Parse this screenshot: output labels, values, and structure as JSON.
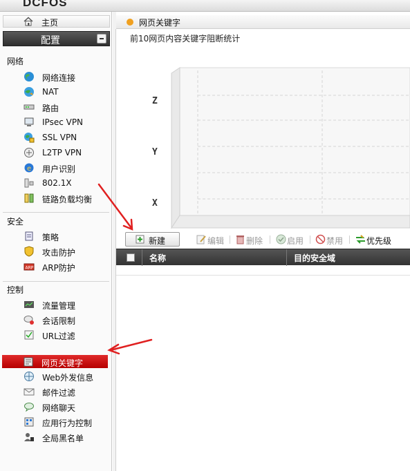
{
  "brand": {
    "name": "DCFOS"
  },
  "sidebar": {
    "home_label": "主页",
    "config_label": "配置",
    "groups": [
      {
        "title": "网络",
        "items": [
          {
            "label": "网络连接",
            "icon": "globe-icon"
          },
          {
            "label": "NAT",
            "icon": "nat-globe-icon"
          },
          {
            "label": "路由",
            "icon": "router-icon"
          },
          {
            "label": "IPsec VPN",
            "icon": "vpn-monitor-icon"
          },
          {
            "label": "SSL VPN",
            "icon": "ssl-vpn-icon"
          },
          {
            "label": "L2TP VPN",
            "icon": "l2tp-vpn-icon"
          },
          {
            "label": "用户识别",
            "icon": "ie-globe-icon"
          },
          {
            "label": "802.1X",
            "icon": "switch-icon"
          },
          {
            "label": "链路负载均衡",
            "icon": "load-balance-icon"
          }
        ]
      },
      {
        "title": "安全",
        "items": [
          {
            "label": "策略",
            "icon": "policy-icon"
          },
          {
            "label": "攻击防护",
            "icon": "shield-icon"
          },
          {
            "label": "ARP防护",
            "icon": "arp-icon"
          }
        ]
      },
      {
        "title": "控制",
        "items": [
          {
            "label": "流量管理",
            "icon": "traffic-icon"
          },
          {
            "label": "会话限制",
            "icon": "session-icon"
          },
          {
            "label": "URL过滤",
            "icon": "url-filter-icon"
          },
          {
            "label": "网页关键字",
            "icon": "keyword-icon",
            "active": true
          },
          {
            "label": "Web外发信息",
            "icon": "web-post-icon"
          },
          {
            "label": "邮件过滤",
            "icon": "mail-filter-icon"
          },
          {
            "label": "网络聊天",
            "icon": "chat-icon"
          },
          {
            "label": "应用行为控制",
            "icon": "app-control-icon"
          },
          {
            "label": "全局黑名单",
            "icon": "blacklist-icon"
          }
        ]
      }
    ]
  },
  "main": {
    "header_title": "网页关键字",
    "subtitle": "前10网页内容关键字阻断统计",
    "chart_axis_labels": [
      "Z",
      "Y",
      "X"
    ],
    "toolbar": {
      "new_label": "新建",
      "edit_label": "编辑",
      "delete_label": "删除",
      "enable_label": "启用",
      "disable_label": "禁用",
      "priority_label": "优先级"
    },
    "table": {
      "columns": [
        "名称",
        "目的安全域"
      ]
    }
  },
  "colors": {
    "active_item": "#cc0000",
    "header_dot": "#f0a020",
    "table_header": "#444444",
    "annotation_arrow": "#e02020"
  }
}
